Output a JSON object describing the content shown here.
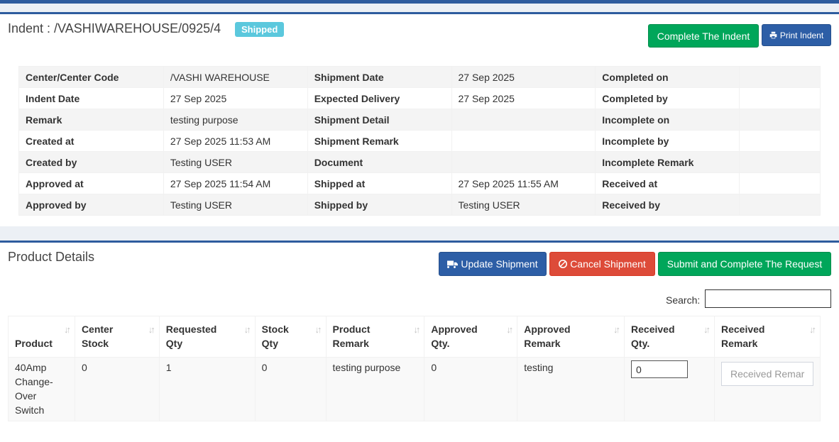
{
  "header": {
    "title": "Indent : /VASHIWAREHOUSE/0925/4",
    "status": "Shipped",
    "complete_button": "Complete The Indent",
    "print_button": "Print Indent"
  },
  "info": {
    "rows": [
      [
        "Center/Center Code",
        "/VASHI WAREHOUSE",
        "Shipment Date",
        "27 Sep 2025",
        "Completed on",
        ""
      ],
      [
        "Indent Date",
        "27 Sep 2025",
        "Expected Delivery",
        "27 Sep 2025",
        "Completed by",
        ""
      ],
      [
        "Remark",
        "testing purpose",
        "Shipment Detail",
        "",
        "Incomplete on",
        ""
      ],
      [
        "Created at",
        "27 Sep 2025 11:53 AM",
        "Shipment Remark",
        "",
        "Incomplete by",
        ""
      ],
      [
        "Created by",
        "Testing USER",
        "Document",
        "",
        "Incomplete Remark",
        ""
      ],
      [
        "Approved at",
        "27 Sep 2025 11:54 AM",
        "Shipped at",
        "27 Sep 2025 11:55 AM",
        "Received at",
        ""
      ],
      [
        "Approved by",
        "Testing USER",
        "Shipped by",
        "Testing USER",
        "Received by",
        ""
      ]
    ]
  },
  "products": {
    "title": "Product Details",
    "update_button": "Update Shipment",
    "cancel_button": "Cancel Shipment",
    "submit_button": "Submit and Complete The Request",
    "search_label": "Search:",
    "columns": [
      [
        "Product"
      ],
      [
        "Center",
        "Stock"
      ],
      [
        "Requested",
        "Qty"
      ],
      [
        "Stock",
        "Qty"
      ],
      [
        "Product",
        "Remark"
      ],
      [
        "Approved",
        "Qty."
      ],
      [
        "Approved",
        "Remark"
      ],
      [
        "Received",
        "Qty."
      ],
      [
        "Received",
        "Remark"
      ]
    ],
    "row": {
      "product": [
        "40Amp",
        "Change-",
        "Over",
        "Switch"
      ],
      "center_stock": "0",
      "requested_qty": "1",
      "stock_qty": "0",
      "product_remark": "testing purpose",
      "approved_qty": "0",
      "approved_remark": "testing",
      "received_qty": "0",
      "received_remark_placeholder": "Received Remar"
    }
  }
}
